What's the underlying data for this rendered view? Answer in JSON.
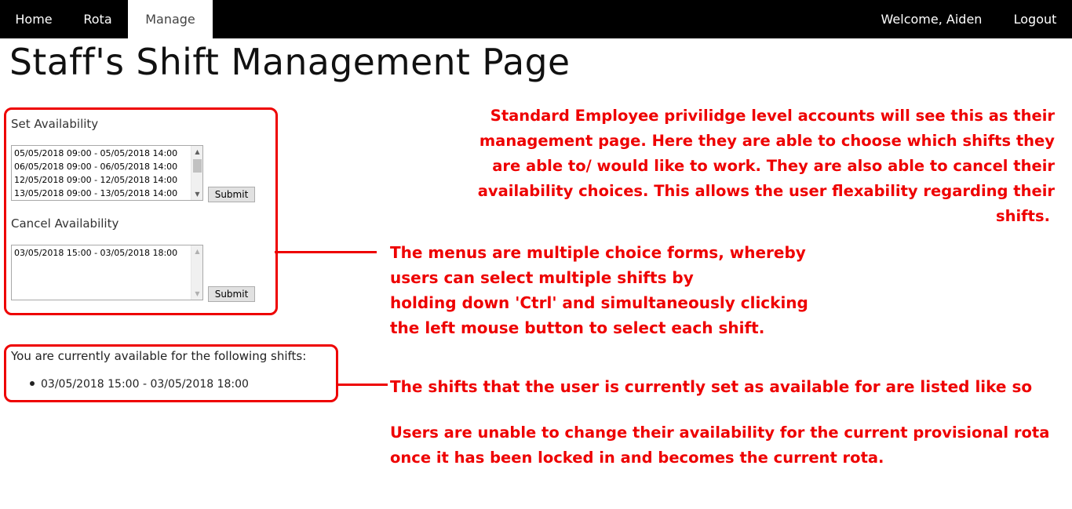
{
  "nav": {
    "home": "Home",
    "rota": "Rota",
    "manage": "Manage",
    "welcome": "Welcome, Aiden",
    "logout": "Logout",
    "active_tab": "Manage"
  },
  "page_title": "Staff's Shift Management Page",
  "set_availability": {
    "label": "Set Availability",
    "options": [
      "05/05/2018 09:00 - 05/05/2018 14:00",
      "06/05/2018 09:00 - 06/05/2018 14:00",
      "12/05/2018 09:00 - 12/05/2018 14:00",
      "13/05/2018 09:00 - 13/05/2018 14:00"
    ],
    "submit_label": "Submit"
  },
  "cancel_availability": {
    "label": "Cancel Availability",
    "options": [
      "03/05/2018 15:00 - 03/05/2018 18:00"
    ],
    "submit_label": "Submit"
  },
  "available_shifts": {
    "heading": "You are currently available for the following shifts:",
    "items": [
      "03/05/2018 15:00 - 03/05/2018 18:00"
    ]
  },
  "annotations": {
    "note_1": [
      "Standard Employee privilidge level accounts will see this as their",
      "management page. Here they are able to choose which shifts they",
      "are able to/ would like to work. They are also able to cancel their",
      "availability choices. This allows the user flexability regarding their",
      "shifts."
    ],
    "note_2": [
      "The menus are multiple choice forms, whereby",
      "users can select multiple shifts by",
      "holding down 'Ctrl' and simultaneously clicking",
      "the left mouse button to select each shift."
    ],
    "note_3": "The shifts that the user is currently set as available for are listed like so",
    "note_4": [
      "Users are unable to change their availability for the current provisional rota",
      "once it has been locked in and becomes the current rota."
    ]
  },
  "colors": {
    "navbar": "#000000",
    "annotation": "#ee0000",
    "highlight_border": "#ee0000"
  }
}
